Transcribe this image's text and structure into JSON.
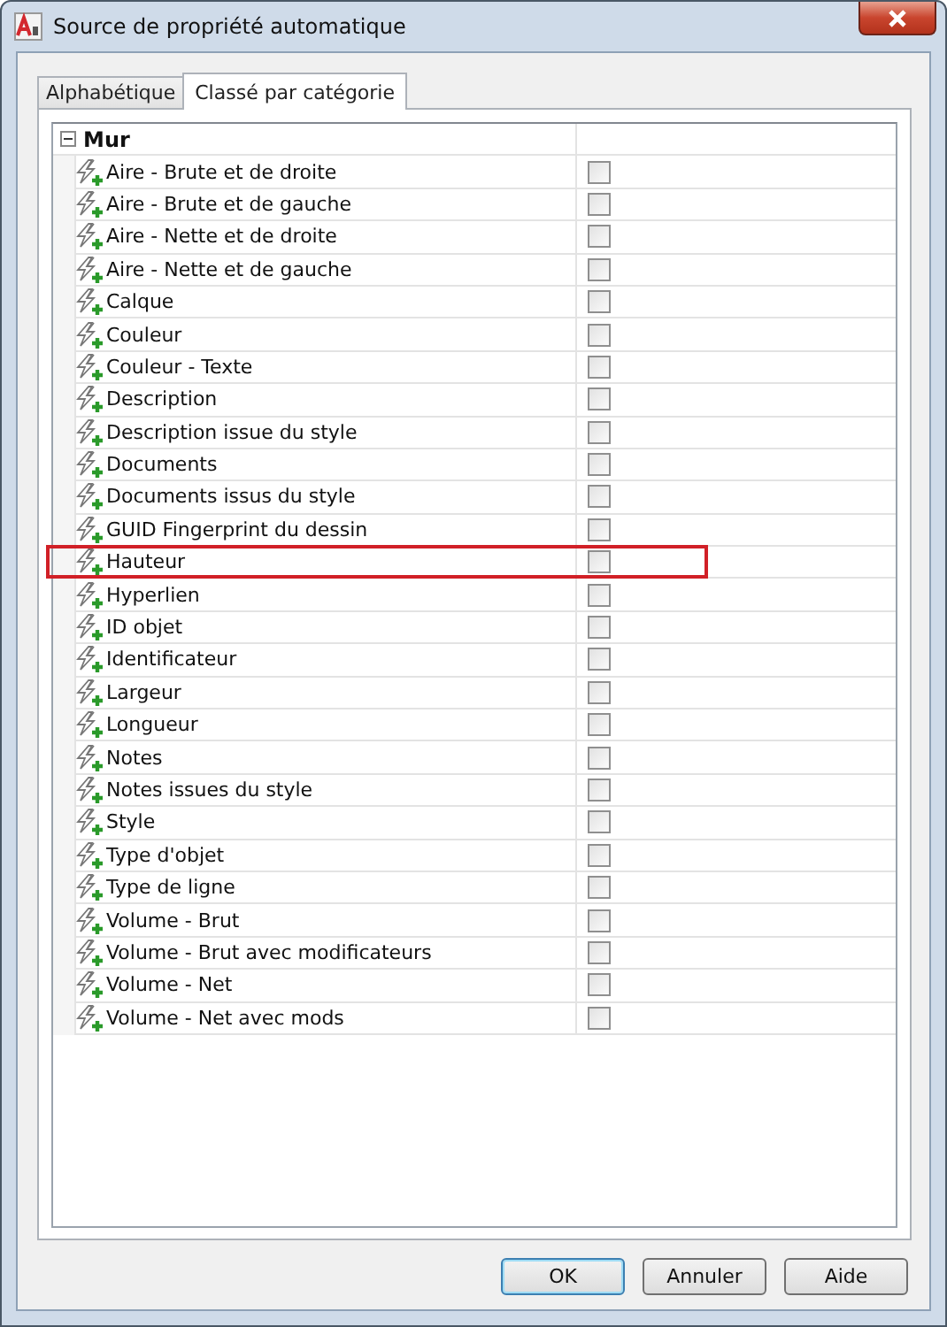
{
  "window": {
    "title": "Source de propriété automatique"
  },
  "tabs": [
    {
      "label": "Alphabétique",
      "selected": false
    },
    {
      "label": "Classé par catégorie",
      "selected": true
    }
  ],
  "groups": [
    {
      "name": "Mur",
      "expanded": true,
      "properties": [
        {
          "name": "Aire - Brute et de droite",
          "checked": false,
          "highlighted": false
        },
        {
          "name": "Aire - Brute et de gauche",
          "checked": false,
          "highlighted": false
        },
        {
          "name": "Aire - Nette et de droite",
          "checked": false,
          "highlighted": false
        },
        {
          "name": "Aire - Nette et de gauche",
          "checked": false,
          "highlighted": false
        },
        {
          "name": "Calque",
          "checked": false,
          "highlighted": false
        },
        {
          "name": "Couleur",
          "checked": false,
          "highlighted": false
        },
        {
          "name": "Couleur - Texte",
          "checked": false,
          "highlighted": false
        },
        {
          "name": "Description",
          "checked": false,
          "highlighted": false
        },
        {
          "name": "Description issue du style",
          "checked": false,
          "highlighted": false
        },
        {
          "name": "Documents",
          "checked": false,
          "highlighted": false
        },
        {
          "name": "Documents issus du style",
          "checked": false,
          "highlighted": false
        },
        {
          "name": "GUID Fingerprint du dessin",
          "checked": false,
          "highlighted": false
        },
        {
          "name": "Hauteur",
          "checked": false,
          "highlighted": true
        },
        {
          "name": "Hyperlien",
          "checked": false,
          "highlighted": false
        },
        {
          "name": "ID objet",
          "checked": false,
          "highlighted": false
        },
        {
          "name": "Identificateur",
          "checked": false,
          "highlighted": false
        },
        {
          "name": "Largeur",
          "checked": false,
          "highlighted": false
        },
        {
          "name": "Longueur",
          "checked": false,
          "highlighted": false
        },
        {
          "name": "Notes",
          "checked": false,
          "highlighted": false
        },
        {
          "name": "Notes issues du style",
          "checked": false,
          "highlighted": false
        },
        {
          "name": "Style",
          "checked": false,
          "highlighted": false
        },
        {
          "name": "Type d'objet",
          "checked": false,
          "highlighted": false
        },
        {
          "name": "Type de ligne",
          "checked": false,
          "highlighted": false
        },
        {
          "name": "Volume - Brut",
          "checked": false,
          "highlighted": false
        },
        {
          "name": "Volume - Brut avec modificateurs",
          "checked": false,
          "highlighted": false
        },
        {
          "name": "Volume - Net",
          "checked": false,
          "highlighted": false
        },
        {
          "name": "Volume - Net avec mods",
          "checked": false,
          "highlighted": false
        }
      ]
    }
  ],
  "buttons": [
    {
      "label": "OK",
      "default": true
    },
    {
      "label": "Annuler",
      "default": false
    },
    {
      "label": "Aide",
      "default": false
    }
  ]
}
